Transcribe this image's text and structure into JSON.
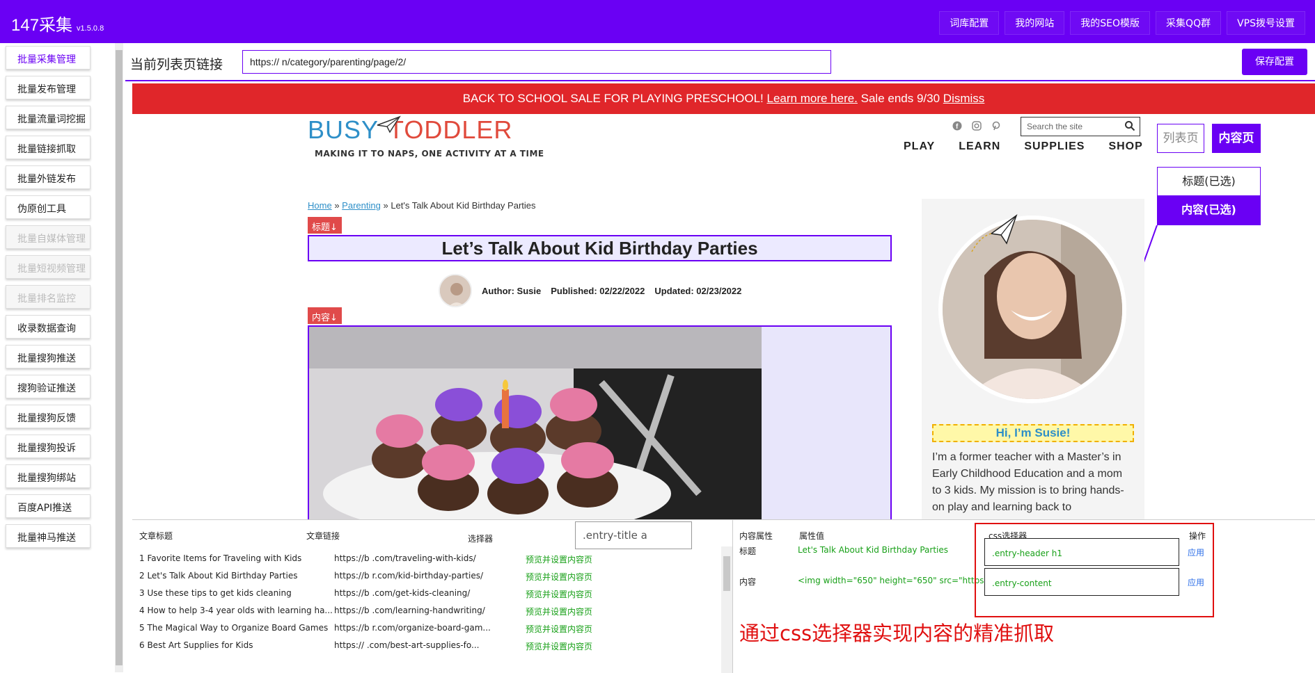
{
  "app": {
    "title": "147采集",
    "version": "v1.5.0.8"
  },
  "topnav": [
    "词库配置",
    "我的网站",
    "我的SEO模版",
    "采集QQ群",
    "VPS拨号设置"
  ],
  "sidebar": [
    {
      "label": "批量采集管理",
      "state": "active"
    },
    {
      "label": "批量发布管理",
      "state": "normal"
    },
    {
      "label": "批量流量词挖掘",
      "state": "normal"
    },
    {
      "label": "批量链接抓取",
      "state": "normal"
    },
    {
      "label": "批量外链发布",
      "state": "normal"
    },
    {
      "label": "伪原创工具",
      "state": "normal"
    },
    {
      "label": "批量自媒体管理",
      "state": "disabled"
    },
    {
      "label": "批量短视频管理",
      "state": "disabled"
    },
    {
      "label": "批量排名监控",
      "state": "disabled"
    },
    {
      "label": "收录数据查询",
      "state": "normal"
    },
    {
      "label": "批量搜狗推送",
      "state": "normal"
    },
    {
      "label": "搜狗验证推送",
      "state": "normal"
    },
    {
      "label": "批量搜狗反馈",
      "state": "normal"
    },
    {
      "label": "批量搜狗投诉",
      "state": "normal"
    },
    {
      "label": "批量搜狗绑站",
      "state": "normal"
    },
    {
      "label": "百度API推送",
      "state": "normal"
    },
    {
      "label": "批量神马推送",
      "state": "normal"
    }
  ],
  "urlbar": {
    "label": "当前列表页链接",
    "value": "https://                  n/category/parenting/page/2/",
    "save": "保存配置"
  },
  "promo": {
    "text": "BACK TO SCHOOL SALE FOR PLAYING PRESCHOOL!",
    "learn": "Learn more here.",
    "ends": "Sale ends 9/30",
    "dismiss": "Dismiss"
  },
  "site": {
    "logo_busy": "BUSY",
    "logo_toddler": "TODDLER",
    "tagline": "MAKING IT TO NAPS, ONE ACTIVITY AT A TIME",
    "search_placeholder": "Search the site",
    "nav": [
      "PLAY",
      "LEARN",
      "SUPPLIES",
      "SHOP"
    ],
    "breadcrumb": {
      "home": "Home",
      "sep": "»",
      "parenting": "Parenting",
      "current": "Let's Talk About Kid Birthday Parties"
    },
    "title_tag": "标题↓",
    "content_tag": "内容↓",
    "article_title": "Let’s Talk About Kid Birthday Parties",
    "author": "Author: Susie",
    "published": "Published: 02/22/2022",
    "updated": "Updated: 02/23/2022",
    "hi": "Hi, I’m Susie!",
    "bio": "I’m a former teacher with a Master’s in Early Childhood Education and a mom to 3 kids. My mission is to bring hands-on play and learning back to"
  },
  "mode_tabs": {
    "list": "列表页",
    "content": "内容页"
  },
  "selected": {
    "title": "标题(已选)",
    "content": "内容(已选)"
  },
  "list_panel": {
    "headers": [
      "文章标题",
      "文章链接",
      "选择器"
    ],
    "selector_value": ".entry-title a",
    "rows": [
      {
        "title": "1 Favorite Items for Traveling with Kids",
        "url": "https://b             .com/traveling-with-kids/",
        "action": "预览并设置内容页"
      },
      {
        "title": "2 Let's Talk About Kid Birthday Parties",
        "url": "https://b           r.com/kid-birthday-parties/",
        "action": "预览并设置内容页"
      },
      {
        "title": "3 Use these tips to get kids cleaning",
        "url": "https://b             .com/get-kids-cleaning/",
        "action": "预览并设置内容页"
      },
      {
        "title": "4 How to help 3-4 year olds with learning ha...",
        "url": "https://b            .com/learning-handwriting/",
        "action": "预览并设置内容页"
      },
      {
        "title": "5 The Magical Way to Organize Board Games",
        "url": "https://b           r.com/organize-board-gam...",
        "action": "预览并设置内容页"
      },
      {
        "title": "6 Best Art Supplies for Kids",
        "url": "https://             .com/best-art-supplies-fo...",
        "action": "预览并设置内容页"
      }
    ]
  },
  "detail_panel": {
    "headers": [
      "内容属性",
      "属性值",
      "css选择器",
      "操作"
    ],
    "rows": [
      {
        "attr": "标题",
        "value": "Let's Talk About Kid Birthday Parties",
        "css": ".entry-header h1",
        "op": "应用"
      },
      {
        "attr": "内容",
        "value": "<img width=\"650\" height=\"650\" src=\"https://busyt...",
        "css": ".entry-content",
        "op": "应用"
      }
    ],
    "caption": "通过css选择器实现内容的精准抓取"
  },
  "colors": {
    "brand": "#6a00f4",
    "promo": "#e0262a",
    "tag": "#e04a4a",
    "link_green": "#18a018",
    "caption_red": "#e01010"
  },
  "icons": [
    "facebook-icon",
    "instagram-icon",
    "pinterest-icon",
    "search-icon",
    "paper-plane-icon"
  ]
}
